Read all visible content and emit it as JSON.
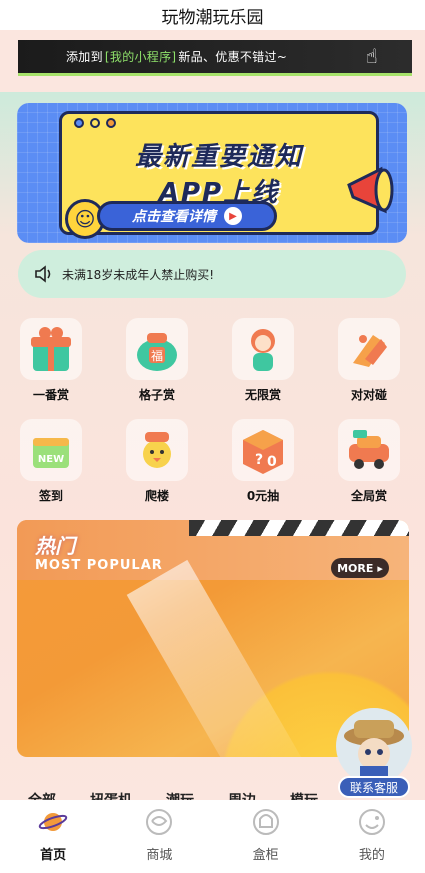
{
  "header": {
    "title": "玩物潮玩乐园"
  },
  "mini_program_bar": {
    "prefix": "添加到",
    "highlight": "[我的小程序]",
    "suffix": "新品、优惠不错过~"
  },
  "banner": {
    "line1": "最新重要通知",
    "line2": "APP上线",
    "button": "点击查看详情"
  },
  "notice": {
    "text": "未满18岁未成年人禁止购买!"
  },
  "categories": [
    {
      "label": "一番赏",
      "icon": "gift-box-icon"
    },
    {
      "label": "格子赏",
      "icon": "lucky-bag-icon"
    },
    {
      "label": "无限赏",
      "icon": "figure-icon"
    },
    {
      "label": "对对碰",
      "icon": "hand-icon"
    },
    {
      "label": "签到",
      "icon": "calendar-icon"
    },
    {
      "label": "爬楼",
      "icon": "duck-icon"
    },
    {
      "label": "0元抽",
      "icon": "mystery-box-icon"
    },
    {
      "label": "全局赏",
      "icon": "car-icon"
    }
  ],
  "hot": {
    "title": "热门",
    "subtitle": "MOST POPULAR",
    "more": "MORE"
  },
  "customer_service": {
    "label": "联系客服"
  },
  "filters": [
    "全部",
    "扭蛋机",
    "潮玩",
    "周边",
    "模玩"
  ],
  "tabbar": [
    {
      "label": "首页",
      "icon": "planet-icon",
      "active": true
    },
    {
      "label": "商城",
      "icon": "store-icon",
      "active": false
    },
    {
      "label": "盒柜",
      "icon": "box-cabinet-icon",
      "active": false
    },
    {
      "label": "我的",
      "icon": "profile-icon",
      "active": false
    }
  ],
  "colors": {
    "accent_green": "#8ee06a",
    "banner_blue": "#5b8df4",
    "banner_yellow": "#fde35c",
    "hot_orange": "#f59a3b",
    "cs_blue": "#3a5fb8"
  }
}
